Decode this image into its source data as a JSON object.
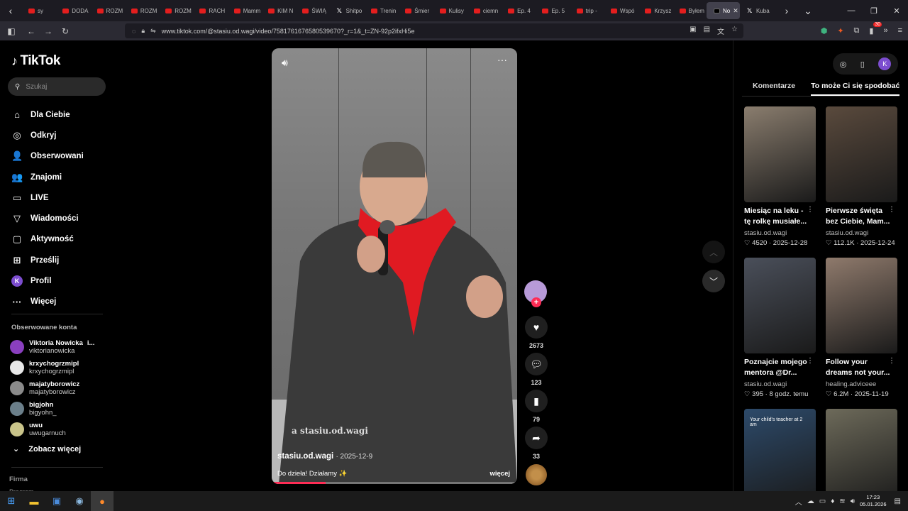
{
  "browser": {
    "tabs": [
      {
        "label": "sy",
        "fav": "youtube"
      },
      {
        "label": "DODA",
        "fav": "youtube"
      },
      {
        "label": "ROZM",
        "fav": "youtube"
      },
      {
        "label": "ROZM",
        "fav": "youtube"
      },
      {
        "label": "ROZM",
        "fav": "youtube"
      },
      {
        "label": "RACH",
        "fav": "youtube"
      },
      {
        "label": "Mamm",
        "fav": "youtube"
      },
      {
        "label": "KIM N",
        "fav": "youtube"
      },
      {
        "label": "ŚWIĄ",
        "fav": "youtube"
      },
      {
        "label": "Shitpo",
        "fav": "x"
      },
      {
        "label": "Trenin",
        "fav": "youtube"
      },
      {
        "label": "Śmier",
        "fav": "youtube"
      },
      {
        "label": "Kulisy",
        "fav": "youtube"
      },
      {
        "label": "ciemn",
        "fav": "youtube"
      },
      {
        "label": "Ep. 4",
        "fav": "youtube"
      },
      {
        "label": "Ep. 5",
        "fav": "youtube"
      },
      {
        "label": "trip -",
        "fav": "youtube"
      },
      {
        "label": "Wspó",
        "fav": "youtube"
      },
      {
        "label": "Krzysz",
        "fav": "youtube"
      },
      {
        "label": "Byłem",
        "fav": "youtube"
      }
    ],
    "active_tab": {
      "label": "No"
    },
    "last_tab": {
      "label": "Kuba"
    },
    "url": "www.tiktok.com/@stasiu.od.wagi/video/7581761676580539670?_r=1&_t=ZN-92p2ifxHi5e",
    "badge_count": "30"
  },
  "tiktok": {
    "logo": "TikTok",
    "search_placeholder": "Szukaj",
    "nav": [
      {
        "label": "Dla Ciebie",
        "icon": "home-icon",
        "glyph": "⌂"
      },
      {
        "label": "Odkryj",
        "icon": "compass-icon",
        "glyph": "◎"
      },
      {
        "label": "Obserwowani",
        "icon": "following-icon",
        "glyph": "👤"
      },
      {
        "label": "Znajomi",
        "icon": "friends-icon",
        "glyph": "👥"
      },
      {
        "label": "LIVE",
        "icon": "live-icon",
        "glyph": "▭"
      },
      {
        "label": "Wiadomości",
        "icon": "messages-icon",
        "glyph": "▽"
      },
      {
        "label": "Aktywność",
        "icon": "activity-icon",
        "glyph": "▢"
      },
      {
        "label": "Prześlij",
        "icon": "upload-icon",
        "glyph": "⊞"
      },
      {
        "label": "Profil",
        "icon": "profile-icon",
        "glyph": "K"
      },
      {
        "label": "Więcej",
        "icon": "more-icon",
        "glyph": "···"
      }
    ],
    "followed_title": "Obserwowane konta",
    "followed": [
      {
        "name": "Viktoria Nowicka",
        "badge": "i...",
        "handle": "viktorianowicka",
        "color": "#8a3fbf"
      },
      {
        "name": "krxychogrzmipl",
        "handle": "krxychogrzmipl",
        "color": "#e8e8e8"
      },
      {
        "name": "majatyborowicz",
        "handle": "majatyborowicz",
        "color": "#8a8a8a"
      },
      {
        "name": "bigjohn",
        "handle": "bigyohn_",
        "color": "#6b7f8a"
      },
      {
        "name": "uwu",
        "handle": "uwugarnuch",
        "color": "#c9c48a"
      }
    ],
    "see_more": "Zobacz więcej",
    "footer": {
      "company": "Firma",
      "program": "Program"
    }
  },
  "video": {
    "watermark": "a stasiu.od.wagi",
    "author": "stasiu.od.wagi",
    "date": "· 2025-12-9",
    "description": "Do dzieła! Działamy ✨",
    "more": "więcej",
    "progress": 0.22,
    "likes": "2673",
    "comments": "123",
    "saves": "79",
    "shares": "33"
  },
  "right_panel": {
    "tabs": [
      "Komentarze",
      "To może Ci się spodobać"
    ],
    "active_tab": 1,
    "cards": [
      {
        "title": "Miesiąc na leku - tę rolkę musiałe...",
        "author": "stasiu.od.wagi",
        "stats": "♡ 4520 · 2025-12-28",
        "color": "#8a7d6e"
      },
      {
        "title": "Pierwsze święta bez Ciebie, Mam...",
        "author": "stasiu.od.wagi",
        "stats": "♡ 112.1K · 2025-12-24",
        "color": "#5a4a3d"
      },
      {
        "title": "Poznajcie mojego mentora @Dr...",
        "author": "stasiu.od.wagi",
        "stats": "♡ 395 · 8 godz. temu",
        "color": "#4a4f5a"
      },
      {
        "title": "Follow your dreams not your...",
        "author": "healing.adviceee",
        "stats": "♡ 6.2M · 2025-11-19",
        "color": "#8f7a6c"
      },
      {
        "title": "",
        "author": "",
        "stats": "",
        "color": "#2d4a6a",
        "overlay": "Your child's teacher at 2 am"
      },
      {
        "title": "",
        "author": "",
        "stats": "",
        "color": "#6d6a5a"
      }
    ]
  },
  "taskbar": {
    "time": "17:23",
    "date": "05.01.2026"
  }
}
